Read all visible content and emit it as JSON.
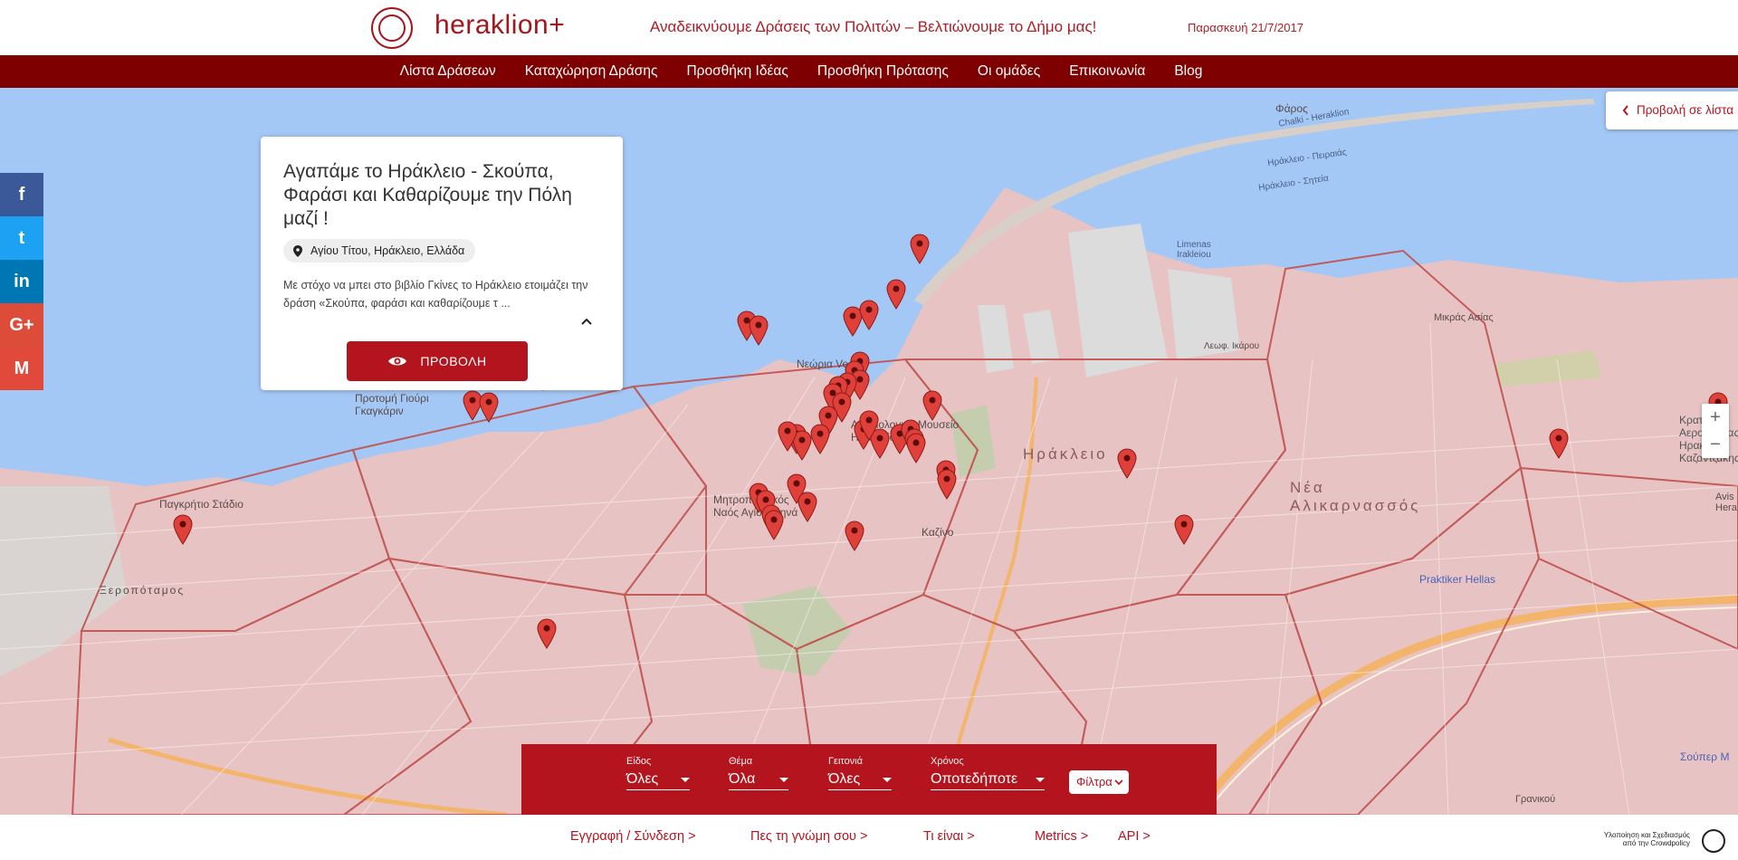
{
  "header": {
    "logo_text": "heraklion+",
    "tagline": "Αναδεικνύουμε Δράσεις των Πολιτών – Βελτιώνουμε το Δήμο μας!",
    "date": "Παρασκευή 21/7/2017"
  },
  "nav": {
    "items": [
      "Λίστα Δράσεων",
      "Καταχώρηση Δράσης",
      "Προσθήκη Ιδέας",
      "Προσθήκη Πρότασης",
      "Οι ομάδες",
      "Επικοινωνία",
      "Blog"
    ]
  },
  "card": {
    "title": "Αγαπάμε το Ηράκλειο - Σκούπα, Φαράσι και Καθαρίζουμε την Πόλη μαζί !",
    "location": "Αγίου Τίτου, Ηράκλειο, Ελλάδα",
    "description": "Με στόχο να μπει στο βιβλίο Γκίνες το Ηράκλειο ετοιμάζει την δράση «Σκούπα, φαράσι και καθαρίζουμε τ ...",
    "button": "ΠΡΟΒΟΛΗ"
  },
  "list_view_button": "Προβολή σε λίστα",
  "zoom": {
    "in": "+",
    "out": "−"
  },
  "social": {
    "facebook": "f",
    "twitter": "t",
    "linkedin": "in",
    "googleplus": "G+",
    "gmail": "M"
  },
  "map": {
    "labels": {
      "faros": "Φάρος",
      "neoria": "Νεώρια Vechi",
      "protomi": "Προτομή Γιούρι Γκαγκάριν",
      "pagkritio": "Παγκρήτιο Στάδιο",
      "mitropolitikos": "Μητροπολιτικός Ναός Αγίου Μηνά",
      "archaiologiko": "Αρχαιολογικό Μουσείο Ηρακλείου",
      "heraklion": "Ηράκλειο",
      "nea_alikarnassos": "Νέα Αλικαρνασσός",
      "kazino": "Καζίνο",
      "praktiker": "Praktiker Hellas",
      "supermarket": "Σούπερ Μ",
      "limenas": "Limenas Irakleiou",
      "xeropotamos": "Ξεροπόταμος",
      "leof_ikarou": "Λεωφ. Ικάρου",
      "mikros_asias": "Μικράς Ασίας",
      "airport": "Κρατικός Αερολιμένας Ηρακλείου Καζαντζάκης",
      "aviation": "Avis Hera",
      "gournes": "Γρανικού",
      "shipping1": "Chalki - Heraklion",
      "shipping2": "Ηράκλειο - Πειραιάς",
      "shipping3": "Ηράκλειο - Σητεία"
    },
    "marker_count": 44
  },
  "filters": {
    "eidos": {
      "label": "Είδος",
      "value": "Όλες"
    },
    "thema": {
      "label": "Θέμα",
      "value": "Όλα"
    },
    "geitonia": {
      "label": "Γειτονιά",
      "value": "Όλες"
    },
    "xronos": {
      "label": "Χρόνος",
      "value": "Οποτεδήποτε"
    },
    "filters_button": "Φίλτρα"
  },
  "footer": {
    "links": [
      "Εγγραφή / Σύνδεση >",
      "Πες τη γνώμη σου >",
      "Τι είναι >",
      "Metrics >",
      "API >"
    ],
    "credit": "Υλοποίηση και Σχεδιασμός από την Crowdpolicy"
  },
  "colors": {
    "brand_red": "#b3141e",
    "nav_dark_red": "#7f0000",
    "sea": "#a4c8f6",
    "city_overlay": "#e8c3c3",
    "marker": "#e0403a"
  }
}
